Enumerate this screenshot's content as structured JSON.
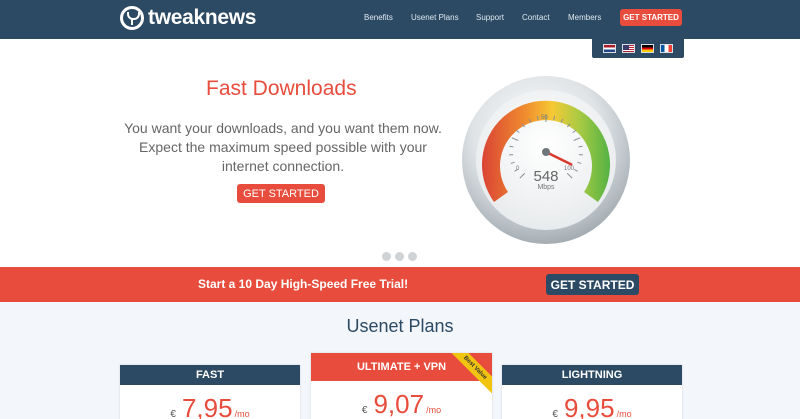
{
  "brand": {
    "name": "tweaknews"
  },
  "nav": {
    "items": [
      "Benefits",
      "Usenet Plans",
      "Support",
      "Contact",
      "Members"
    ],
    "cta": "GET STARTED"
  },
  "languages": [
    "Dutch",
    "English (US)",
    "German",
    "French"
  ],
  "hero": {
    "title": "Fast Downloads",
    "lines": [
      "You want your downloads, and you want them now.",
      "Expect the maximum speed possible with your",
      "internet connection."
    ],
    "cta": "GET STARTED",
    "slides": 3,
    "gauge": {
      "value": "548",
      "unit": "Mbps",
      "scale_labels": [
        "0",
        "50",
        "100"
      ],
      "needle_fraction": 0.93
    }
  },
  "trial_banner": {
    "text": "Start a 10 Day High-Speed Free Trial!",
    "cta": "GET STARTED"
  },
  "plans": {
    "title": "Usenet Plans",
    "currency": "€",
    "per": "/mo",
    "items": [
      {
        "name": "FAST",
        "price": "7,95"
      },
      {
        "name": "ULTIMATE + VPN",
        "price": "9,07",
        "badge": "Best Value"
      },
      {
        "name": "LIGHTNING",
        "price": "9,95"
      }
    ]
  },
  "colors": {
    "nav_bg": "#2c4a63",
    "accent_red": "#e74c3c",
    "badge_yellow": "#f1c40f",
    "page_bg": "#f3f6fb"
  }
}
